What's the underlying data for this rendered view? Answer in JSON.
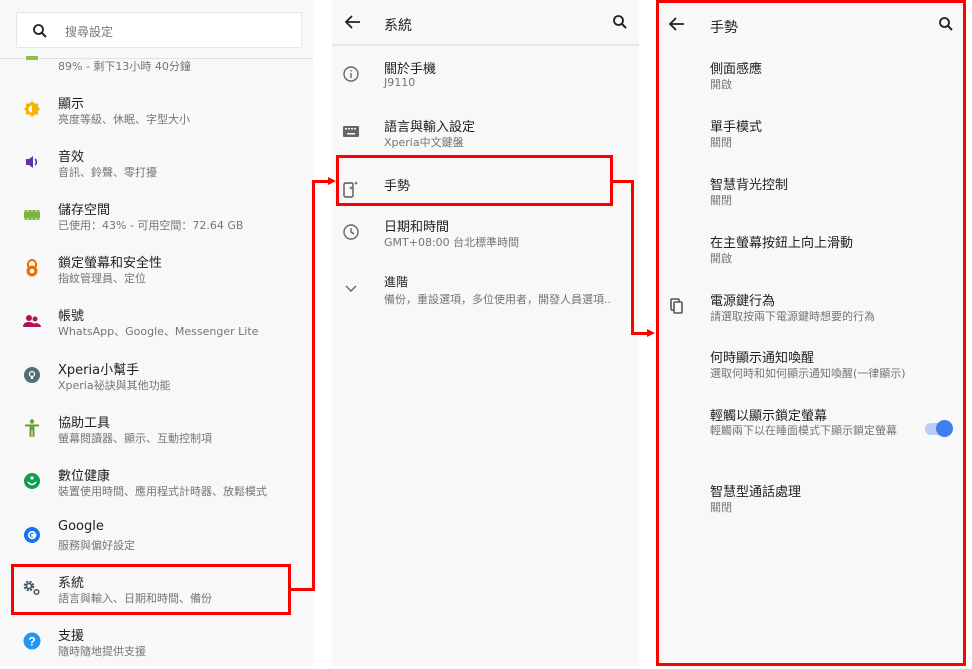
{
  "settings": {
    "search_placeholder": "搜尋設定",
    "battery_sub": "89% - 剩下13小時 40分鐘",
    "items": [
      {
        "title": "顯示",
        "sub": "亮度等級、休眠、字型大小"
      },
      {
        "title": "音效",
        "sub": "音訊、鈴聲、零打擾"
      },
      {
        "title": "儲存空間",
        "sub": "已使用：43% - 可用空間：72.64 GB"
      },
      {
        "title": "鎖定螢幕和安全性",
        "sub": "指紋管理員、定位"
      },
      {
        "title": "帳號",
        "sub": "WhatsApp、Google、Messenger Lite"
      },
      {
        "title": "Xperia小幫手",
        "sub": "Xperia祕訣與其他功能"
      },
      {
        "title": "協助工具",
        "sub": "螢幕閱讀器、顯示、互動控制項"
      },
      {
        "title": "數位健康",
        "sub": "裝置使用時間、應用程式計時器、放鬆模式"
      },
      {
        "title": "Google",
        "sub": "服務與偏好設定"
      },
      {
        "title": "系統",
        "sub": "語言與輸入、日期和時間、備份"
      },
      {
        "title": "支援",
        "sub": "隨時隨地提供支援"
      }
    ]
  },
  "system": {
    "title": "系統",
    "items": [
      {
        "title": "關於手機",
        "sub": "J9110"
      },
      {
        "title": "語言與輸入設定",
        "sub": "Xperia中文鍵盤"
      },
      {
        "title": "手勢",
        "sub": ""
      },
      {
        "title": "日期和時間",
        "sub": "GMT+08:00 台北標準時間"
      },
      {
        "title": "進階",
        "sub": "備份，重設選項，多位使用者，開發人員選項.."
      }
    ]
  },
  "gestures": {
    "title": "手勢",
    "items": [
      {
        "title": "側面感應",
        "sub": "開啟"
      },
      {
        "title": "單手模式",
        "sub": "關閉"
      },
      {
        "title": "智慧背光控制",
        "sub": "關閉"
      },
      {
        "title": "在主螢幕按鈕上向上滑動",
        "sub": "開啟"
      },
      {
        "title": "電源鍵行為",
        "sub": "請選取按兩下電源鍵時想要的行為"
      },
      {
        "title": "何時顯示通知喚醒",
        "sub": "選取何時和如何顯示通知喚醒(一律顯示)"
      },
      {
        "title": "輕觸以顯示鎖定螢幕",
        "sub": "輕觸兩下以在睡面模式下顯示鎖定螢幕",
        "toggle_on": true
      },
      {
        "title": "智慧型通話處理",
        "sub": "關閉"
      }
    ]
  },
  "colors": {
    "highlight": "#ff0000",
    "toggle": "#3d7ef0"
  }
}
